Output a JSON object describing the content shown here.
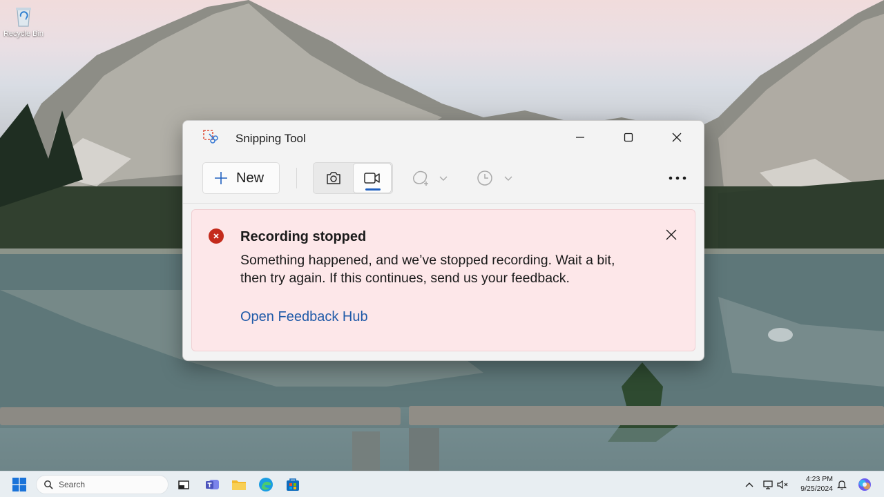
{
  "desktop": {
    "recycle_bin_label": "Recycle Bin"
  },
  "window": {
    "title": "Snipping Tool",
    "app_icon": "snipping-tool-icon",
    "caption_icons": [
      "minimize-icon",
      "maximize-icon",
      "close-icon"
    ]
  },
  "toolbar": {
    "new_label": "New",
    "modes": [
      {
        "name": "screenshot",
        "icon": "camera-icon",
        "selected": false
      },
      {
        "name": "record",
        "icon": "video-camera-icon",
        "selected": true
      }
    ],
    "shape_icon": "freeform-shape-icon",
    "delay_icon": "clock-icon",
    "more_icon": "more-icon"
  },
  "banner": {
    "title": "Recording stopped",
    "message": "Something happened, and we’ve stopped recording. Wait a bit, then try again. If this continues, send us your feedback.",
    "link": "Open Feedback Hub",
    "colors": {
      "background": "#fde7e9",
      "error": "#c42b1c",
      "link": "#1f5aa8"
    }
  },
  "taskbar": {
    "search_placeholder": "Search",
    "apps": [
      "start-icon",
      "task-view-icon",
      "teams-icon",
      "file-explorer-icon",
      "edge-icon",
      "store-icon"
    ],
    "tray": {
      "time": "4:23 PM",
      "date": "9/25/2024"
    }
  }
}
